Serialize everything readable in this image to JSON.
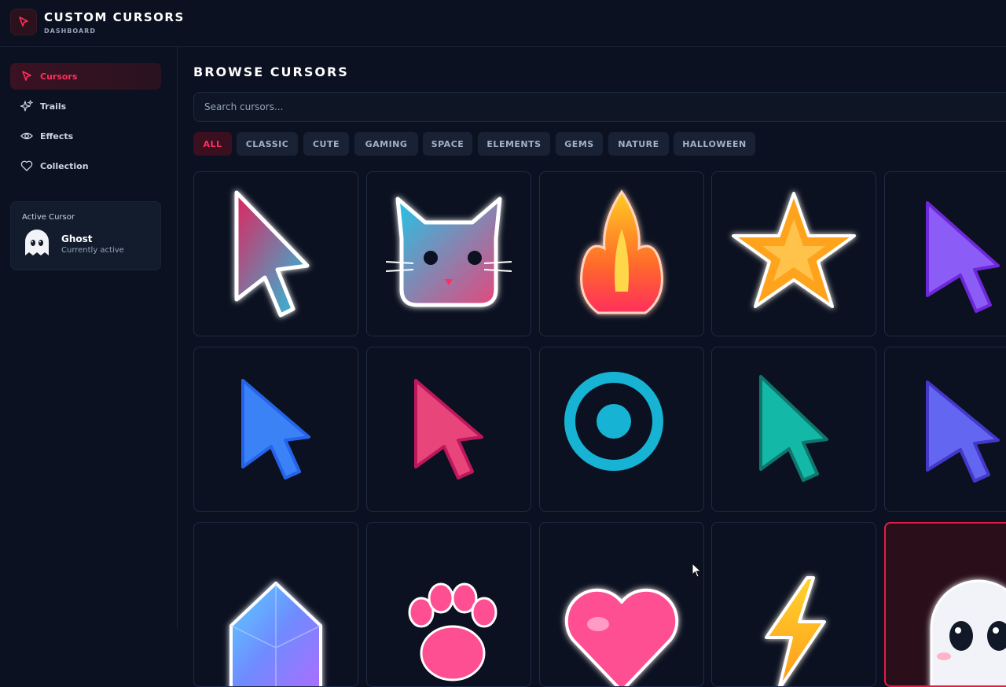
{
  "app": {
    "title": "CUSTOM CURSORS",
    "subtitle": "DASHBOARD",
    "logo_icon": "cursor-arrow-icon"
  },
  "sidebar": {
    "items": [
      {
        "label": "Cursors",
        "icon": "cursor-arrow-icon",
        "active": true
      },
      {
        "label": "Trails",
        "icon": "sparkles-icon",
        "active": false
      },
      {
        "label": "Effects",
        "icon": "eye-icon",
        "active": false
      },
      {
        "label": "Collection",
        "icon": "heart-icon",
        "active": false
      }
    ],
    "active_cursor": {
      "label": "Active Cursor",
      "name": "Ghost",
      "status": "Currently active"
    }
  },
  "main": {
    "title": "BROWSE CURSORS",
    "search": {
      "placeholder": "Search cursors...",
      "value": ""
    },
    "filters": [
      "ALL",
      "CLASSIC",
      "CUTE",
      "GAMING",
      "SPACE",
      "ELEMENTS",
      "GEMS",
      "NATURE",
      "HALLOWEEN"
    ],
    "active_filter": "ALL",
    "cursors": [
      {
        "name": "gradient-arrow-cursor",
        "selected": false
      },
      {
        "name": "cat-face-cursor",
        "selected": false
      },
      {
        "name": "flame-cursor",
        "selected": false
      },
      {
        "name": "star-cursor",
        "selected": false
      },
      {
        "name": "purple-arrow-cursor",
        "selected": false
      },
      {
        "name": "blue-arrow-cursor",
        "selected": false
      },
      {
        "name": "pink-arrow-cursor",
        "selected": false
      },
      {
        "name": "target-ring-cursor",
        "selected": false
      },
      {
        "name": "teal-arrow-cursor",
        "selected": false
      },
      {
        "name": "indigo-arrow-cursor",
        "selected": false
      },
      {
        "name": "crystal-gem-cursor",
        "selected": false
      },
      {
        "name": "paw-print-cursor",
        "selected": false
      },
      {
        "name": "heart-cursor",
        "selected": false
      },
      {
        "name": "lightning-bolt-cursor",
        "selected": false
      },
      {
        "name": "ghost-cursor",
        "selected": true
      }
    ]
  },
  "colors": {
    "accent": "#ff2e5c",
    "background": "#0b1120",
    "card_border": "#1f2a48"
  }
}
